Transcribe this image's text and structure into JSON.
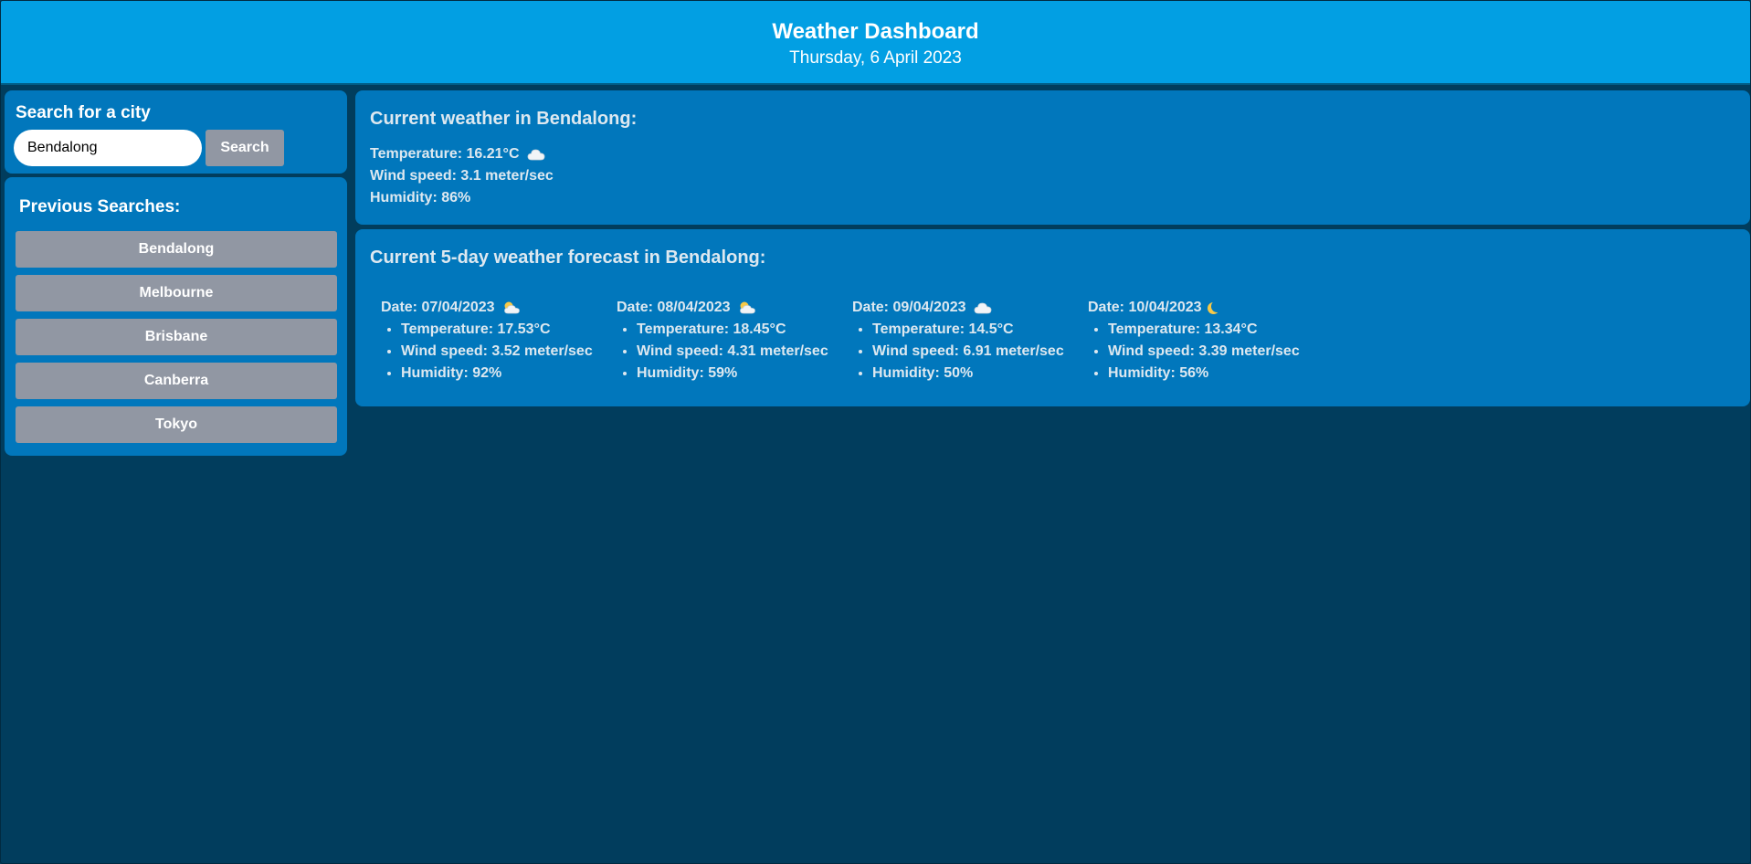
{
  "header": {
    "title": "Weather Dashboard",
    "date": "Thursday, 6 April 2023"
  },
  "search": {
    "heading": "Search for a city",
    "input_value": "Bendalong",
    "button_label": "Search"
  },
  "previous": {
    "heading": "Previous Searches:",
    "items": [
      "Bendalong",
      "Melbourne",
      "Brisbane",
      "Canberra",
      "Tokyo"
    ]
  },
  "current": {
    "heading": "Current weather in Bendalong:",
    "temperature": "Temperature: 16.21°C",
    "icon": "cloud-icon",
    "wind": "Wind speed: 3.1 meter/sec",
    "humidity": "Humidity: 86%"
  },
  "forecast": {
    "heading": "Current 5-day weather forecast in Bendalong:",
    "days": [
      {
        "date": "Date: 07/04/2023",
        "icon": "sun-behind-cloud-icon",
        "temperature": "Temperature: 17.53°C",
        "wind": "Wind speed: 3.52 meter/sec",
        "humidity": "Humidity: 92%"
      },
      {
        "date": "Date: 08/04/2023",
        "icon": "sun-behind-cloud-icon",
        "temperature": "Temperature: 18.45°C",
        "wind": "Wind speed: 4.31 meter/sec",
        "humidity": "Humidity: 59%"
      },
      {
        "date": "Date: 09/04/2023",
        "icon": "cloud-icon",
        "temperature": "Temperature: 14.5°C",
        "wind": "Wind speed: 6.91 meter/sec",
        "humidity": "Humidity: 50%"
      },
      {
        "date": "Date: 10/04/2023",
        "icon": "moon-icon",
        "temperature": "Temperature: 13.34°C",
        "wind": "Wind speed: 3.39 meter/sec",
        "humidity": "Humidity: 56%"
      }
    ]
  },
  "colors": {
    "header_bg": "#029fe3",
    "page_bg": "#013d5d",
    "card_bg": "#0177bc",
    "button_bg": "#9197a3"
  }
}
